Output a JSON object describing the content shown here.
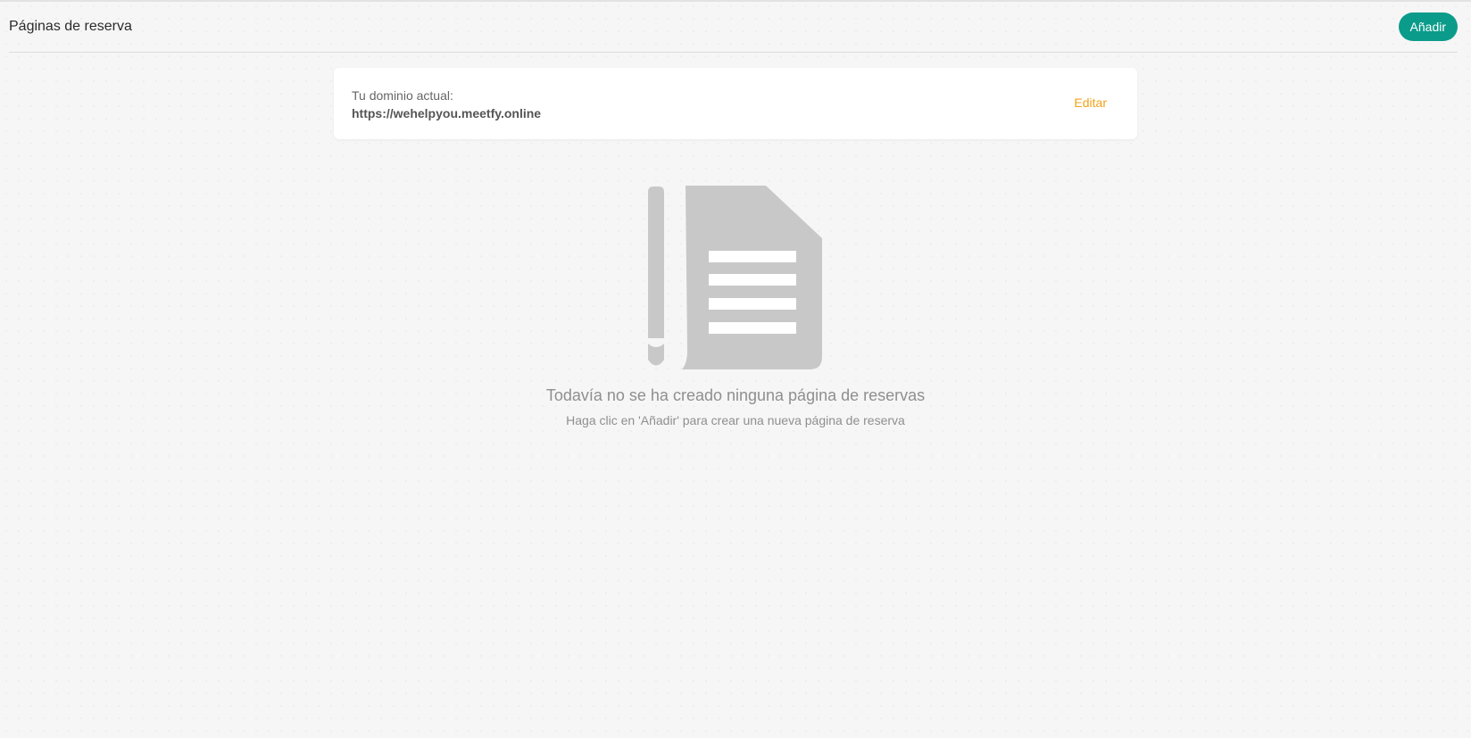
{
  "header": {
    "title": "Páginas de reserva",
    "add_label": "Añadir"
  },
  "domain_card": {
    "label": "Tu dominio actual:",
    "url": "https://wehelpyou.meetfy.online",
    "edit_label": "Editar"
  },
  "empty_state": {
    "icon": "document-pen-icon",
    "title": "Todavía no se ha creado ninguna página de reservas",
    "subtitle": "Haga clic en 'Añadir' para crear una nueva página de reserva"
  },
  "colors": {
    "accent": "#0b9b8a",
    "link": "#f0a21b",
    "illustration": "#c8c8c8",
    "background": "#f6f6f6"
  }
}
